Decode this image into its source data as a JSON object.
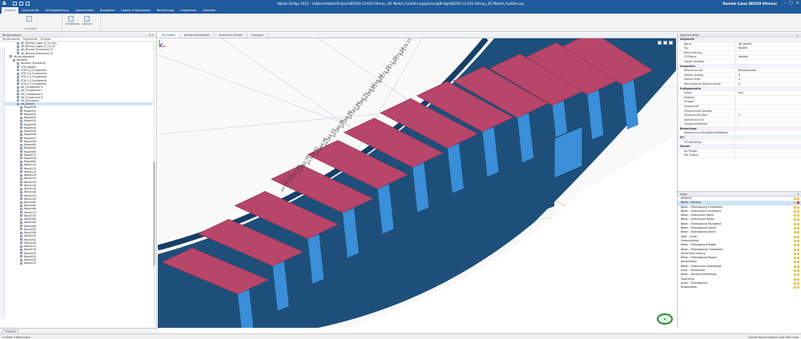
{
  "app": {
    "title": "Allplan Bridge 2022 - \\Allplan\\Allplan\\Projects\\B5264 LU K2b Viterau_3D Modell_Ausführungsplanung\\Bridge\\B5264 LU K2b Viterau_3D Modell_Ausführung",
    "user": "Daniele Lama (B5529 Viterau)",
    "logo": "A"
  },
  "ribbon": {
    "tabs": [
      "Ansicht",
      "Querschnitt",
      "3D Modellierung",
      "Querschnitte",
      "Bauablauf",
      "Lasten & Nachweise",
      "Berechnung",
      "Ergebnisse",
      "Optionen"
    ],
    "active_tab": 0,
    "buttons": [
      {
        "label": "Grundriss",
        "icon": "plan-view-icon"
      },
      {
        "label": "Grafiktools",
        "icon": "graphic-tools-icon"
      },
      {
        "label": "Löschen",
        "icon": "delete-icon"
      }
    ],
    "group_label": "Grundriss"
  },
  "left_panel": {
    "title": "Strukturbaum",
    "tabs": [
      "Strukturbaum",
      "Ergebnisse",
      "Analyse"
    ],
    "side_tabs": [
      "Eigenschaften",
      "Eigenschaften Objekt"
    ],
    "items": [
      {
        "label": "AK_Brücke_Lager_H_14_Sch",
        "level": 2
      },
      {
        "label": "AK_Brücke_Lager_H_14_SE",
        "level": 2
      },
      {
        "label": "AK_Brücke_Rückwand_T1",
        "level": 2
      },
      {
        "label": "AK_Brücke_Rückwand_T2",
        "level": 2
      },
      {
        "label": "Strukturbauteile",
        "level": 0
      },
      {
        "label": "Bauteile",
        "level": 1
      },
      {
        "label": "Konsole (Kreuzend)",
        "level": 2
      },
      {
        "label": "STM_Modell",
        "level": 2
      },
      {
        "label": "STM 0.5_Fundament",
        "level": 2
      },
      {
        "label": "STM 0.5_Fundament",
        "level": 2
      },
      {
        "label": "STM 1.5_Fundament",
        "level": 2
      },
      {
        "label": "STM 2.5_Fundament",
        "level": 2
      },
      {
        "label": "STM 3.5_Fundament",
        "level": 2
      },
      {
        "label": "AK_Fundament H",
        "level": 2
      },
      {
        "label": "AK_Fundament L",
        "level": 2
      },
      {
        "label": "HK_Fundament H",
        "level": 2
      },
      {
        "label": "HK_Fundament R",
        "level": 2
      },
      {
        "label": "HK_Rückwand",
        "level": 2
      },
      {
        "label": "AK_Deckel",
        "level": 2,
        "selected": true
      },
      {
        "label": "Rippe016",
        "level": 3
      },
      {
        "label": "Rippe020",
        "level": 3
      },
      {
        "label": "Rippe024",
        "level": 3
      },
      {
        "label": "Rippe028",
        "level": 3
      },
      {
        "label": "Rippe032",
        "level": 3
      },
      {
        "label": "Rippe036",
        "level": 3
      },
      {
        "label": "Rippe040",
        "level": 3
      },
      {
        "label": "Rippe044",
        "level": 3
      },
      {
        "label": "Rippe048",
        "level": 3
      },
      {
        "label": "Rippe052",
        "level": 3
      },
      {
        "label": "Rippe056",
        "level": 3
      },
      {
        "label": "Rippe060",
        "level": 3
      },
      {
        "label": "Rippe064",
        "level": 3
      },
      {
        "label": "Rippe068",
        "level": 3
      },
      {
        "label": "Rippe072",
        "level": 3
      },
      {
        "label": "Rippe076",
        "level": 3
      },
      {
        "label": "Rippe080",
        "level": 3
      },
      {
        "label": "Wand116",
        "level": 3
      },
      {
        "label": "Wand120",
        "level": 3
      },
      {
        "label": "Wand124",
        "level": 3
      },
      {
        "label": "Wand128",
        "level": 3
      },
      {
        "label": "Wand132",
        "level": 3
      },
      {
        "label": "Wand136",
        "level": 3
      },
      {
        "label": "Wand140",
        "level": 3
      },
      {
        "label": "Wand144",
        "level": 3
      },
      {
        "label": "Wand148",
        "level": 3
      },
      {
        "label": "Wand152",
        "level": 3
      },
      {
        "label": "Wand156",
        "level": 3
      },
      {
        "label": "Wand160",
        "level": 3
      },
      {
        "label": "Wand164",
        "level": 3
      },
      {
        "label": "Wand168",
        "level": 3
      },
      {
        "label": "Wand172",
        "level": 3
      },
      {
        "label": "Wand176",
        "level": 3
      },
      {
        "label": "Wand180",
        "level": 3
      },
      {
        "label": "Wand184",
        "level": 3
      },
      {
        "label": "Wand188",
        "level": 3
      },
      {
        "label": "Wand192",
        "level": 3
      },
      {
        "label": "Wand196",
        "level": 3
      },
      {
        "label": "Wand200",
        "level": 3
      },
      {
        "label": "Wand204",
        "level": 3
      },
      {
        "label": "Wand208",
        "level": 3
      },
      {
        "label": "Wand212",
        "level": 3
      },
      {
        "label": "Wand216",
        "level": 3
      },
      {
        "label": "Wand220",
        "level": 3
      },
      {
        "label": "Wand224",
        "level": 3
      },
      {
        "label": "Wand228",
        "level": 3
      },
      {
        "label": "Wand232",
        "level": 3
      }
    ],
    "footer_button": "Protokoll"
  },
  "view_tabs": [
    "3D Modell",
    "Bauteil-Variationen",
    "Statisches Modell",
    "Vorlagen"
  ],
  "viewport": {
    "station_labels": [
      "s=175.12",
      "s=173.54",
      "s=172.20",
      "s=171.32",
      "s=170.48",
      "s=169.60",
      "s=168.72",
      "s=167.84",
      "s=166.96",
      "s=166.08",
      "s=165.22",
      "s=164.36",
      "s=163.52",
      "s=162.70",
      "s=161.86",
      "s=161.02"
    ],
    "nav_label": "N",
    "colors": {
      "deck_red": "#b8456a",
      "web_blue": "#3a8fd8",
      "dark_blue": "#1d4f7a",
      "deep_blue": "#163f66"
    }
  },
  "right_panel": {
    "title": "Eigenschaften",
    "properties": [
      {
        "cat": "Allgemein"
      },
      {
        "k": "Name",
        "v": "AK_Deckel"
      },
      {
        "k": "Typ",
        "v": "Bauteil"
      },
      {
        "k": "Beschreibung",
        "v": ""
      },
      {
        "k": "GS Ebene",
        "v": "Vertikal"
      },
      {
        "k": "Lokale Variation",
        "v": ""
      },
      {
        "cat": "Geometrie"
      },
      {
        "k": "Referenzachse",
        "v": "Brückenachse"
      },
      {
        "k": "Station Anfang",
        "v": "0"
      },
      {
        "k": "Station Ende",
        "v": "0"
      },
      {
        "k": "Resultierende Referenzlänge",
        "v": "0"
      },
      {
        "cat": "Prüfgeometrie"
      },
      {
        "k": "Achse",
        "v": "Aus"
      },
      {
        "k": "Material",
        "v": ""
      },
      {
        "k": "Gruppe",
        "v": ""
      },
      {
        "k": "Querschnitt",
        "v": ""
      },
      {
        "k": "HQuerschnitt Variabel",
        "v": ""
      },
      {
        "k": "HQuerschnitt Wert",
        "v": "0"
      },
      {
        "k": "Statistiktext Ein",
        "v": ""
      },
      {
        "k": "Längsschnittwerte",
        "v": ""
      },
      {
        "cat": "Bemerkung"
      },
      {
        "k": "Abweichung Haupt/Bauteiltabellen",
        "v": ""
      },
      {
        "cat": "IFC"
      },
      {
        "k": "IFC Bauteiltyp",
        "v": ""
      },
      {
        "cat": "Muster"
      },
      {
        "k": "Als Muster",
        "v": ""
      },
      {
        "k": "Ref. Muster",
        "v": ""
      }
    ],
    "layers_title": "Layer",
    "layers": [
      {
        "label": "DEFAULT",
        "c1": "#e8c650",
        "c2": "#e8c650"
      },
      {
        "label": "Beton - Konsole",
        "c1": "#e8c650",
        "c2": "#c0486f",
        "selected": true
      },
      {
        "label": "Beton - Rücklageung Fundament",
        "c1": "#e8c650",
        "c2": "#e8c650"
      },
      {
        "label": "Beton - Stützmauer Fundament",
        "c1": "#e8c650",
        "c2": "#e8c650"
      },
      {
        "label": "Beton - Stützmauer Wand",
        "c1": "#e8c650",
        "c2": "#e8c650"
      },
      {
        "label": "Beton - Stützmauer Rippe",
        "c1": "#e8c650",
        "c2": "#e8c650"
      },
      {
        "label": "Beton - Rücklageung Rückwand",
        "c1": "#e8c650",
        "c2": "#e8c650"
      },
      {
        "label": "Beton - Rücklageung Decke",
        "c1": "#e8c650",
        "c2": "#e8c650"
      },
      {
        "label": "Beton - Rücklageung Wand",
        "c1": "#e8c650",
        "c2": "#e8c650"
      },
      {
        "label": "Stahl - Anker",
        "c1": "#e8c650",
        "c2": "#e8c650"
      },
      {
        "label": "Erdaushörung",
        "c1": "#e8c650",
        "c2": "#e8c650"
      },
      {
        "label": "Beton - Rücklageung Riegel",
        "c1": "#e8c650",
        "c2": "#e8c650"
      },
      {
        "label": "Beton - Rücklageung Fundament",
        "c1": "#e8c650",
        "c2": "#e8c650"
      },
      {
        "label": "Hinterfüller Erdung",
        "c1": "#e8c650",
        "c2": "#e8c650"
      },
      {
        "label": "Beton - Rücklageung Rippen",
        "c1": "#e8c650",
        "c2": "#e8c650"
      },
      {
        "label": "Konstruktion",
        "c1": "#e8c650",
        "c2": "#e8c650"
      },
      {
        "label": "Beton - Stützmauer Arbeitsfuge",
        "c1": "#e8c650",
        "c2": "#e8c650"
      },
      {
        "label": "Ausb. - Stützmauer",
        "c1": "#e8c650",
        "c2": "#e8c650"
      },
      {
        "label": "Beton - Konsole Arbeitsfuge",
        "c1": "#e8c650",
        "c2": "#e8c650"
      },
      {
        "label": "Geometrie",
        "c1": "#e8c650",
        "c2": "#e8c650"
      },
      {
        "label": "Anker - Rücklageung",
        "c1": "#e8c650",
        "c2": "#e8c650"
      },
      {
        "label": "Bildausfallen",
        "c1": "#e8c650",
        "c2": "#e8c650"
      }
    ]
  },
  "status": {
    "left": "0 Fehler 0 Warnungen",
    "right": "Fenster Bauteil Bauteil Land: Kein Land"
  }
}
